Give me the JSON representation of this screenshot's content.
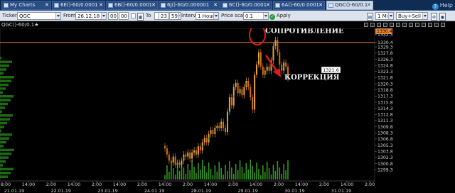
{
  "tabs": [
    {
      "label": "My Charts",
      "active": false
    },
    {
      "label": "6E()-60/0.0001",
      "active": false
    },
    {
      "label": "6B()-60/0.0001",
      "active": false
    },
    {
      "label": "6J()-60/0.000001",
      "active": false
    },
    {
      "label": "6C()-60/0.0001",
      "active": false
    },
    {
      "label": "6A()-60/0.0001",
      "active": false
    },
    {
      "label": "QGC()-60/0.1",
      "active": true
    }
  ],
  "help_label": "Help",
  "toolbar": {
    "ticker_label": "Ticker",
    "ticker_value": "QGC",
    "from_label": "From",
    "from_date": "26.12.18",
    "from_hour": "00",
    "from_min": "00",
    "to_label": "To",
    "to_hour": "23",
    "to_min": "59",
    "interval_label": "Interval",
    "interval_value": "1 Hour",
    "price_scale_label": "Price scale",
    "price_scale_value": "0.1",
    "apply_label": "Apply",
    "timeframe_value": "1 Min",
    "side_value": "Buy+Sell"
  },
  "chart": {
    "label": "QGC()-60/0.1",
    "star": "★",
    "current_price": "1330.4",
    "marked_price": "1321.6",
    "annotation_resistance": "СОПРОТИВЛЕНИЕ",
    "annotation_correction": "КОРРЕКЦИЯ",
    "colors": {
      "up": "#e8a040",
      "down": "#d86a1c",
      "volume": "#3fae2a",
      "level": "#e8873a",
      "annotation_red": "#dd1d1d"
    }
  },
  "chart_data": {
    "type": "candlestick",
    "y_ticks": [
      "1332.3",
      "1330.4",
      "1329.3",
      "1327.8",
      "1326.3",
      "1324.8",
      "1323.3",
      "1321.8",
      "1320.3",
      "1318.8",
      "1317.3",
      "1315.8",
      "1314.3",
      "1312.8",
      "1311.3",
      "1309.8",
      "1308.3",
      "1306.8",
      "1305.3",
      "1303.8",
      "1302.3",
      "1300.8",
      "1299.3"
    ],
    "ylim": [
      1298.8,
      1332.8
    ],
    "x_time_labels": [
      "8:00",
      "14:00",
      "2:00",
      "14:00",
      "2:00",
      "14:00",
      "2:00",
      "14:00",
      "2:00",
      "14:00",
      "2:00",
      "14:00",
      "2:00",
      "14:00",
      "2:00",
      "14:00",
      "2:00"
    ],
    "x_date_labels": [
      "21.01.19",
      "22.01.19",
      "23.01.19",
      "24.01.19",
      "28.01.19",
      "29.01.19",
      "30.01.19",
      "31.01.19"
    ],
    "closes": [
      1304.5,
      1303.0,
      1301.5,
      1301.0,
      1302.5,
      1300.5,
      1301.0,
      1300.5,
      1301.5,
      1303.0,
      1302.5,
      1303.5,
      1302.0,
      1303.5,
      1304.0,
      1303.0,
      1305.0,
      1304.0,
      1306.0,
      1307.0,
      1306.0,
      1308.0,
      1309.0,
      1308.0,
      1309.5,
      1310.0,
      1309.5,
      1311.0,
      1309.5,
      1308.5,
      1313.5,
      1317.0,
      1315.0,
      1319.5,
      1320.5,
      1318.0,
      1319.0,
      1317.5,
      1319.5,
      1321.0,
      1319.5,
      1317.0,
      1314.0,
      1322.5,
      1325.0,
      1328.0,
      1324.5,
      1322.5,
      1323.5,
      1324.5,
      1323.5,
      1326.0,
      1329.5,
      1331.0,
      1328.0,
      1325.0,
      1323.5,
      1325.5,
      1324.5,
      1321.6
    ]
  }
}
